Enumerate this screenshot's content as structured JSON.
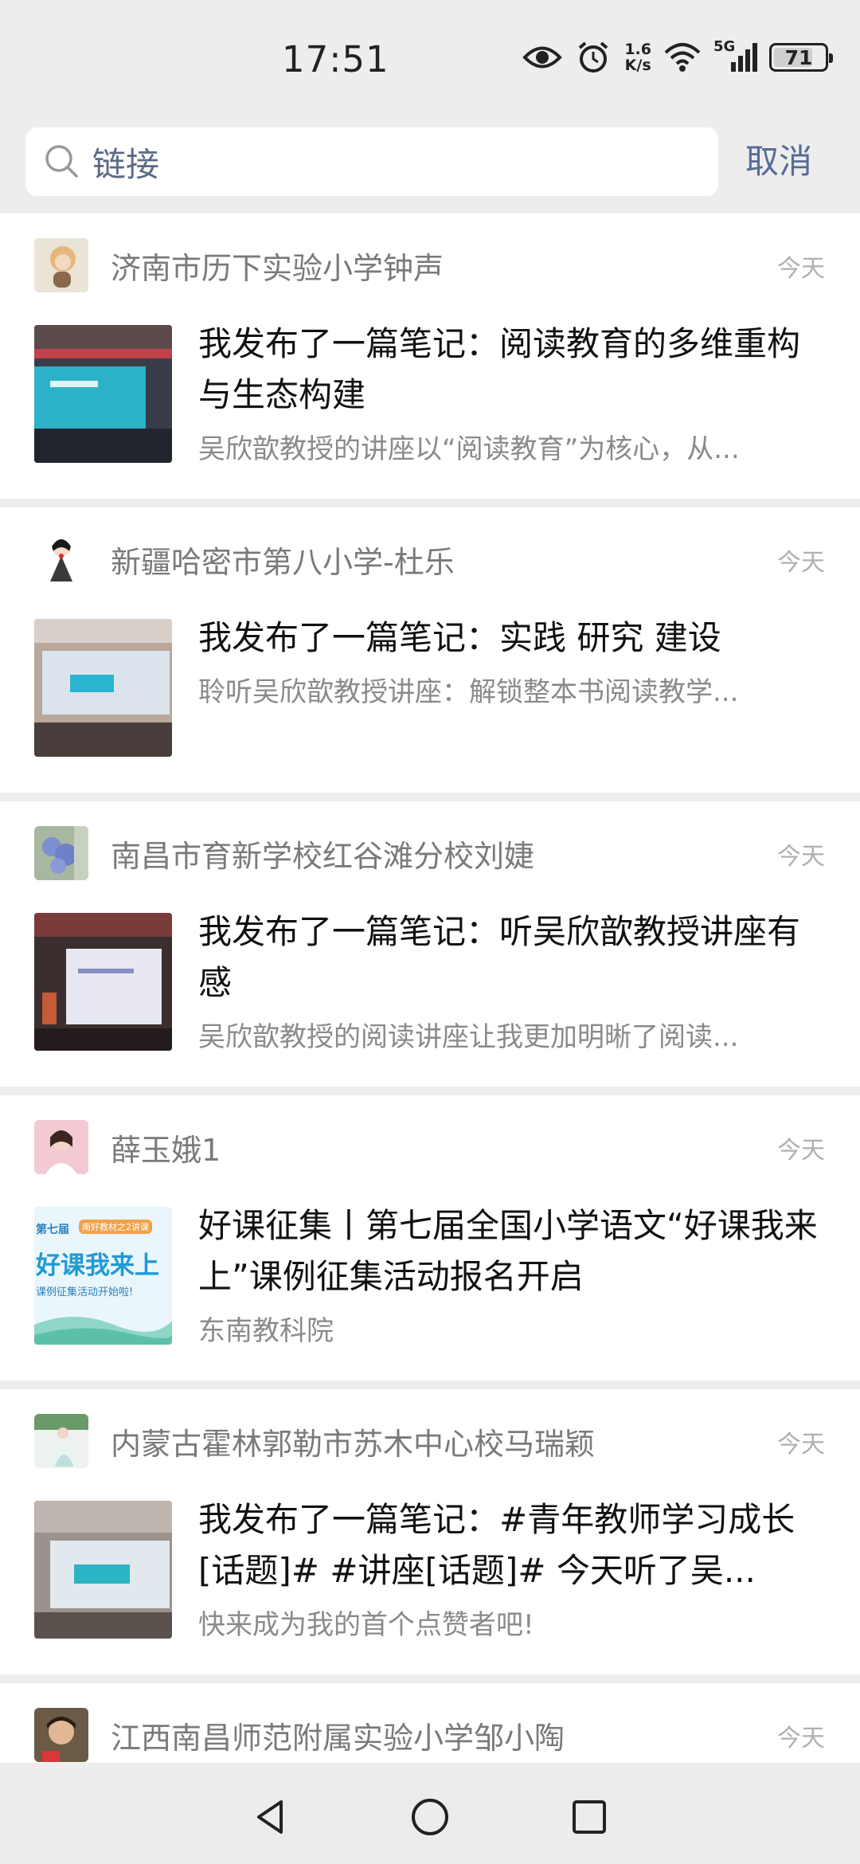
{
  "status_bar": {
    "time": "17:51",
    "net_speed_value": "1.6",
    "net_speed_unit": "K/s",
    "network": "5G",
    "battery": "71"
  },
  "search": {
    "query": "链接",
    "cancel_label": "取消"
  },
  "results": [
    {
      "author": "济南市历下实验小学钟声",
      "time": "今天",
      "title": "我发布了一篇笔记：阅读教育的多维重构与生态构建",
      "subtitle": "吴欣歆教授的讲座以“阅读教育”为核心，从..."
    },
    {
      "author": "新疆哈密市第八小学-杜乐",
      "time": "今天",
      "title": "我发布了一篇笔记：实践  研究  建设",
      "subtitle": "聆听吴欣歆教授讲座：解锁整本书阅读教学..."
    },
    {
      "author": "南昌市育新学校红谷滩分校刘婕",
      "time": "今天",
      "title": "我发布了一篇笔记：听吴欣歆教授讲座有感",
      "subtitle": "吴欣歆教授的阅读讲座让我更加明晰了阅读..."
    },
    {
      "author": "薛玉娥1",
      "time": "今天",
      "title": "好课征集丨第七届全国小学语文“好课我来上”课例征集活动报名开启",
      "subtitle": "东南教科院",
      "thumb_text": {
        "tag": "第七届",
        "ribbon": "南好教材之2讲课",
        "big": "好课我来上",
        "small": "课例征集活动开始啦!"
      }
    },
    {
      "author": "内蒙古霍林郭勒市苏木中心校马瑞颖",
      "time": "今天",
      "title": "我发布了一篇笔记：#青年教师学习成长[话题]# #讲座[话题]# 今天听了吴...",
      "subtitle": "快来成为我的首个点赞者吧!"
    },
    {
      "author": "江西南昌师范附属实验小学邹小陶",
      "time": "今天"
    }
  ]
}
